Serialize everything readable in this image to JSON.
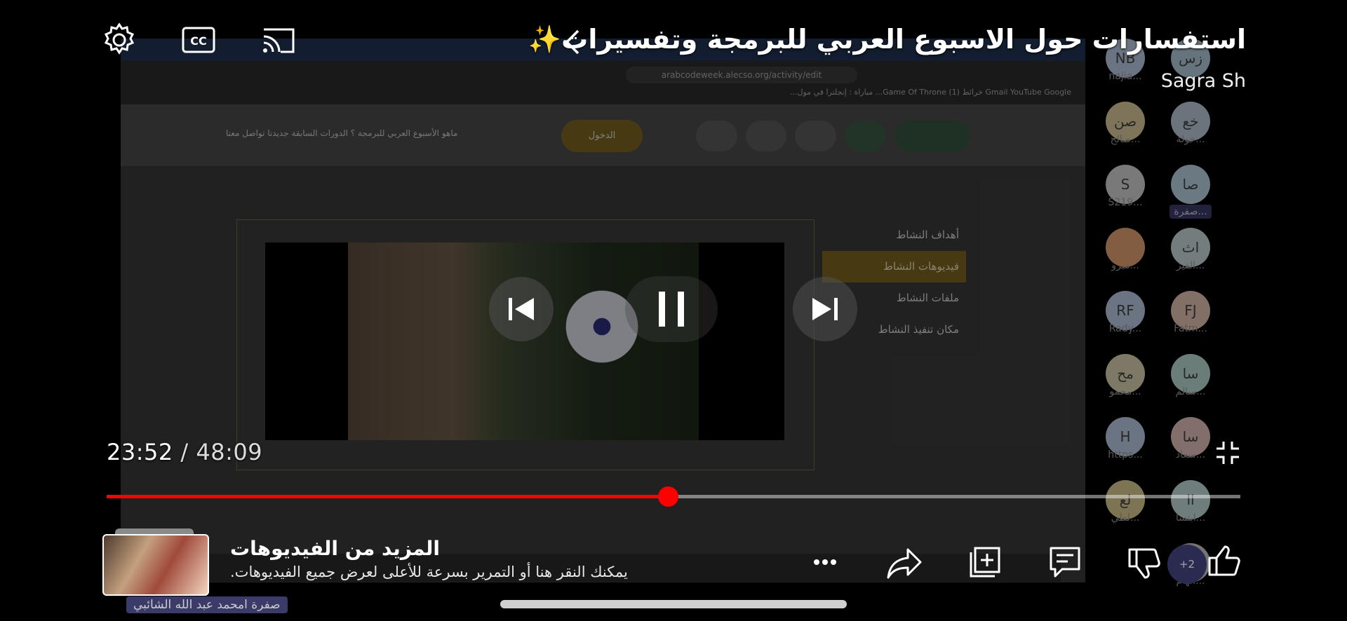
{
  "video": {
    "title": "استفسارات حول الاسبوع العربي للبرمجة وتفسيرات✨",
    "channel": "Sagra Sh",
    "current_time": "23:52",
    "time_separator": "/",
    "duration": "48:09",
    "progress_fraction": 0.495
  },
  "recording": {
    "url": "arabcodeweek.alecso.org/activity/edit",
    "bookmarks": "Gmail  YouTube  Google خرائط  (1) Game Of Throne...  مباراة : إنجلترا في مول...",
    "login_button": "الدخول",
    "nav": "ماهو الأسبوع العربي للبرمجة ؟   الدورات السابقة   جديدنا   تواصل معنا",
    "menu": [
      "أهداف النشاط",
      "فيديوهات النشاط",
      "ملفات النشاط",
      "مكان تنفيذ النشاط"
    ],
    "active_menu_index": 1
  },
  "participants": [
    {
      "initials": "زس",
      "name": "",
      "color": "#b0c8d8"
    },
    {
      "initials": "NB",
      "name": "najia...",
      "color": "#b8c8e0"
    },
    {
      "initials": "خع",
      "name": "خولة...",
      "color": "#b8c8d8"
    },
    {
      "initials": "صن",
      "name": "صالح...",
      "color": "#d8c89a"
    },
    {
      "initials": "صا",
      "name": "صفرة...",
      "color": "#b8d0e0",
      "tag": true
    },
    {
      "initials": "S",
      "name": "S219...",
      "color": "#d0d0d0"
    },
    {
      "initials": "اث",
      "name": "الفيز...",
      "color": "#c8d8d8"
    },
    {
      "initials": "",
      "name": "مبرو...",
      "color": "#e0a070"
    },
    {
      "initials": "FJ",
      "name": "Fatm...",
      "color": "#e0c0b0"
    },
    {
      "initials": "RF",
      "name": "Rady...",
      "color": "#b8c8e0"
    },
    {
      "initials": "سا",
      "name": "سالم...",
      "color": "#b8d8d0"
    },
    {
      "initials": "مح",
      "name": "محمو...",
      "color": "#d8d0b0"
    },
    {
      "initials": "سا",
      "name": "سعاد...",
      "color": "#e0c0b8"
    },
    {
      "initials": "H",
      "name": "https...",
      "color": "#b8c8e0"
    },
    {
      "initials": "اا",
      "name": "ابتسا...",
      "color": "#c0d8d8"
    },
    {
      "initials": "لع",
      "name": "لطي...",
      "color": "#d8c890"
    },
    {
      "initials": "اا",
      "name": "الهام...",
      "color": "#c8c8c8"
    }
  ],
  "more_videos": {
    "title": "المزيد من الفيديوهات",
    "subtitle": "يمكنك النقر هنا أو التمرير بسرعة للأعلى لعرض جميع الفيديوهات."
  },
  "speaker_tag": "صفرة امحمد عبد الله الشائبي",
  "extra_participants": "+2",
  "icons": {
    "settings": "gear-icon",
    "captions": "cc-icon",
    "cast": "cast-icon",
    "previous": "skip-previous-icon",
    "pause": "pause-icon",
    "next": "skip-next-icon",
    "fullscreen_exit": "fullscreen-exit-icon",
    "like": "thumbs-up-icon",
    "dislike": "thumbs-down-icon",
    "comments": "comment-icon",
    "save": "add-to-playlist-icon",
    "share": "share-icon",
    "more": "more-icon"
  },
  "colors": {
    "progress": "#ff0000",
    "active_menu": "#7a6422"
  }
}
